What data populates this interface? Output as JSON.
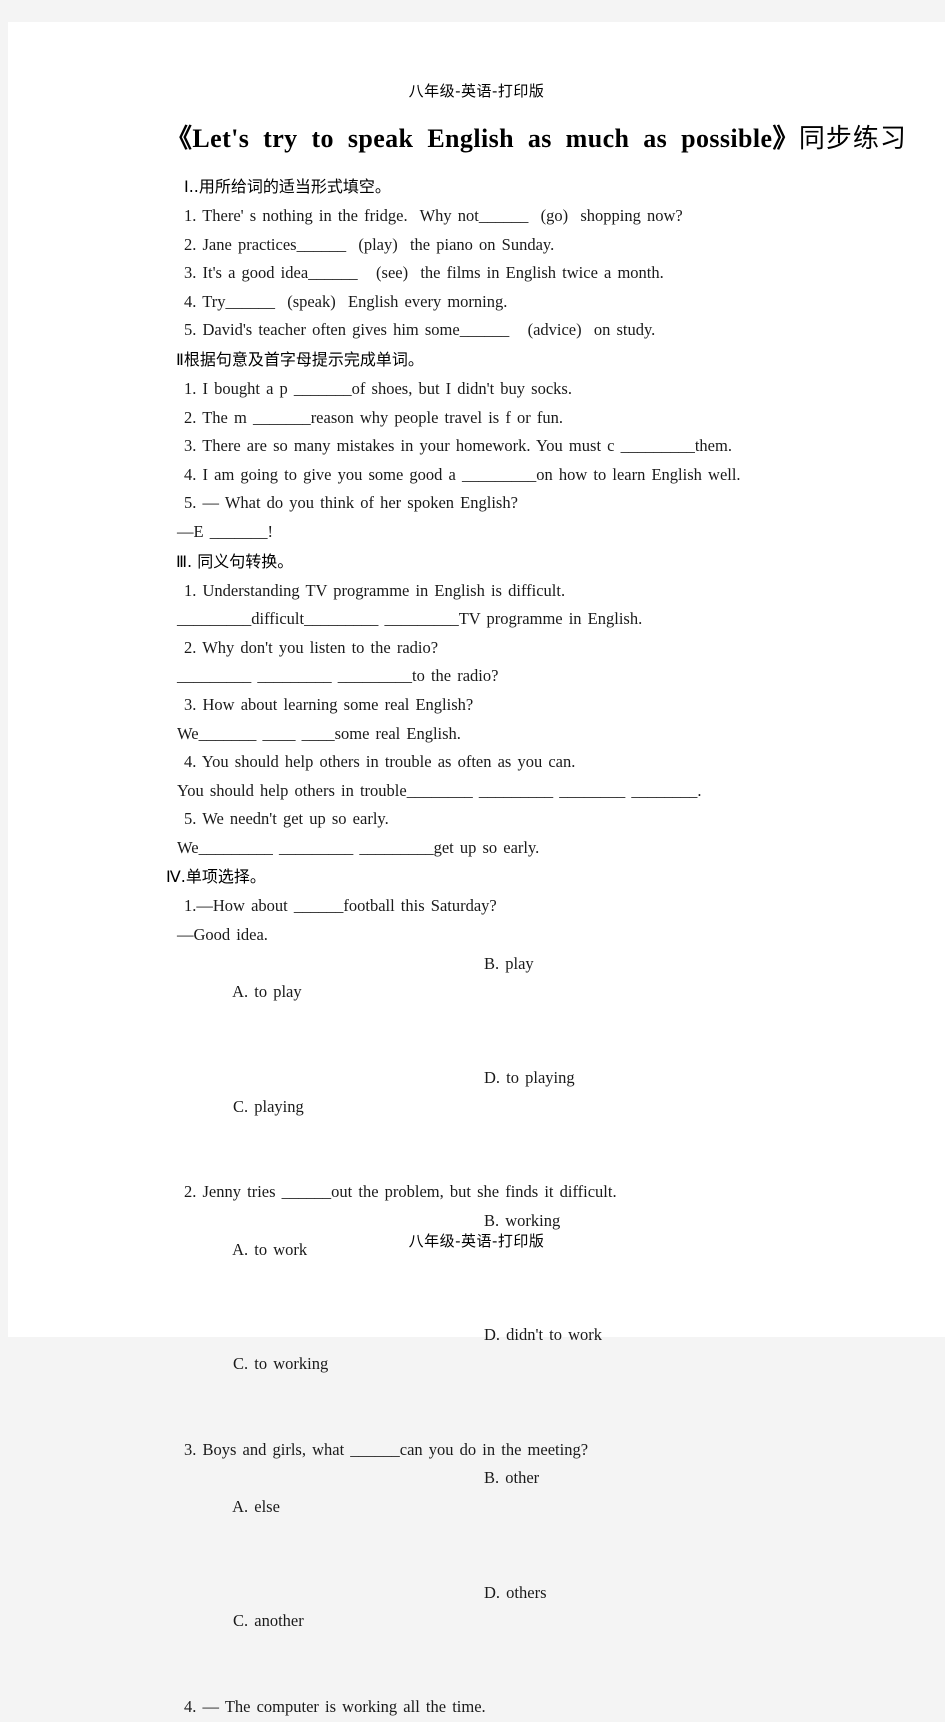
{
  "document": {
    "running_head": "八年级-英语-打印版",
    "running_foot": "八年级-英语-打印版",
    "title_en": "《Let's try to speak English as much as possible》",
    "title_cn": "同步练习"
  },
  "sections": [
    {
      "heading": "Ⅰ..用所给词的适当形式填空。",
      "lines": [
        "1. There' s nothing in the fridge.  Why not______  (go)  shopping now?",
        "2. Jane practices______  (play)  the piano on Sunday.",
        "3. It's a good idea______   (see)  the films in English twice a month.",
        "4. Try______  (speak)  English every morning.",
        "5. David's teacher often gives him some______   (advice)  on study."
      ]
    },
    {
      "heading": "Ⅱ根据句意及首字母提示完成单词。",
      "lines": [
        "1. I bought a p _______of shoes, but I didn't buy socks.",
        "2. The m _______reason why people travel is f or fun.",
        "3. There are so many mistakes in your homework. You must c _________them.",
        "4. I am going to give you some good a _________on how to learn English well.",
        "5. — What do you think of her spoken English?",
        "—E _______!"
      ]
    },
    {
      "heading": "Ⅲ. 同义句转换。",
      "lines": [
        "1. Understanding TV programme in English is difficult.",
        "_________difficult_________ _________TV programme in English.",
        "2. Why don't you listen to the radio?",
        "_________ _________ _________to the radio?",
        "3. How about learning some real English?",
        "We_______ ____ ____some real English.",
        "4. You should help others in trouble as often as you can.",
        "You should help others in trouble________ _________ ________ ________.",
        "5. We needn't get up so early.",
        "We_________ _________ _________get up so early."
      ]
    }
  ],
  "section_four": {
    "heading": "Ⅳ.单项选择。",
    "questions": [
      {
        "stem": "1.—How about ______football this Saturday?",
        "stem2": "—Good idea.",
        "options": [
          {
            "a": "A. to play",
            "b": "B. play"
          },
          {
            "a": "C. playing",
            "b": "D. to playing"
          }
        ]
      },
      {
        "stem": "2. Jenny tries ______out the problem, but she finds it difficult.",
        "stem2": "",
        "options": [
          {
            "a": "A. to work",
            "b": "B. working"
          },
          {
            "a": "C. to working",
            "b": "D. didn't to work"
          }
        ]
      },
      {
        "stem": "3. Boys and girls, what ______can you do in the meeting?",
        "stem2": "",
        "options": [
          {
            "a": "A. else",
            "b": "B. other"
          },
          {
            "a": "C. another",
            "b": "D. others"
          }
        ]
      }
    ],
    "trailing_line": "4. — The computer is working all the time."
  }
}
